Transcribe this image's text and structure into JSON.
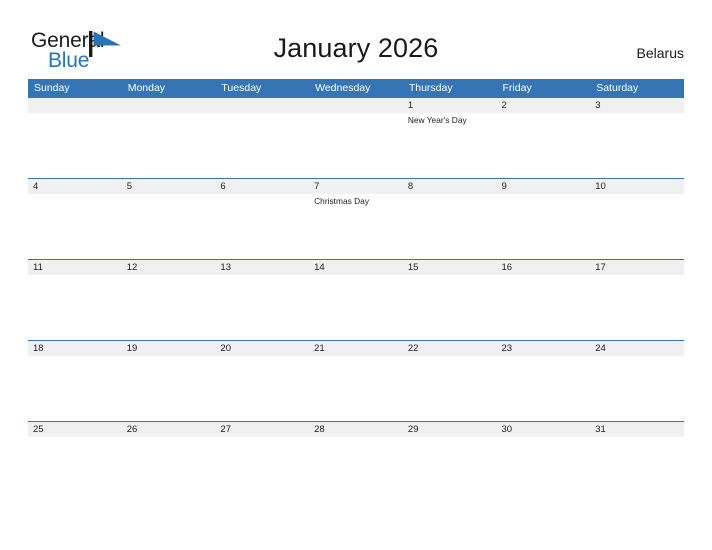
{
  "brand": {
    "name_part1": "General",
    "name_part2": "Blue",
    "flag_icon": "flag-triangle-icon",
    "accent_color": "#2874b6"
  },
  "header": {
    "title": "January 2026",
    "country": "Belarus"
  },
  "theme": {
    "header_blue": "#3575b5",
    "row_band_gray": "#f0f0f0",
    "text_color": "#1f1f1f",
    "page_background": "#ffffff"
  },
  "calendar": {
    "month": "January",
    "year": "2026",
    "weekday_headers": [
      "Sunday",
      "Monday",
      "Tuesday",
      "Wednesday",
      "Thursday",
      "Friday",
      "Saturday"
    ],
    "weeks": [
      [
        {
          "day": "",
          "event": ""
        },
        {
          "day": "",
          "event": ""
        },
        {
          "day": "",
          "event": ""
        },
        {
          "day": "",
          "event": ""
        },
        {
          "day": "1",
          "event": "New Year's Day"
        },
        {
          "day": "2",
          "event": ""
        },
        {
          "day": "3",
          "event": ""
        }
      ],
      [
        {
          "day": "4",
          "event": ""
        },
        {
          "day": "5",
          "event": ""
        },
        {
          "day": "6",
          "event": ""
        },
        {
          "day": "7",
          "event": "Christmas Day"
        },
        {
          "day": "8",
          "event": ""
        },
        {
          "day": "9",
          "event": ""
        },
        {
          "day": "10",
          "event": ""
        }
      ],
      [
        {
          "day": "11",
          "event": ""
        },
        {
          "day": "12",
          "event": ""
        },
        {
          "day": "13",
          "event": ""
        },
        {
          "day": "14",
          "event": ""
        },
        {
          "day": "15",
          "event": ""
        },
        {
          "day": "16",
          "event": ""
        },
        {
          "day": "17",
          "event": ""
        }
      ],
      [
        {
          "day": "18",
          "event": ""
        },
        {
          "day": "19",
          "event": ""
        },
        {
          "day": "20",
          "event": ""
        },
        {
          "day": "21",
          "event": ""
        },
        {
          "day": "22",
          "event": ""
        },
        {
          "day": "23",
          "event": ""
        },
        {
          "day": "24",
          "event": ""
        }
      ],
      [
        {
          "day": "25",
          "event": ""
        },
        {
          "day": "26",
          "event": ""
        },
        {
          "day": "27",
          "event": ""
        },
        {
          "day": "28",
          "event": ""
        },
        {
          "day": "29",
          "event": ""
        },
        {
          "day": "30",
          "event": ""
        },
        {
          "day": "31",
          "event": ""
        }
      ]
    ]
  }
}
